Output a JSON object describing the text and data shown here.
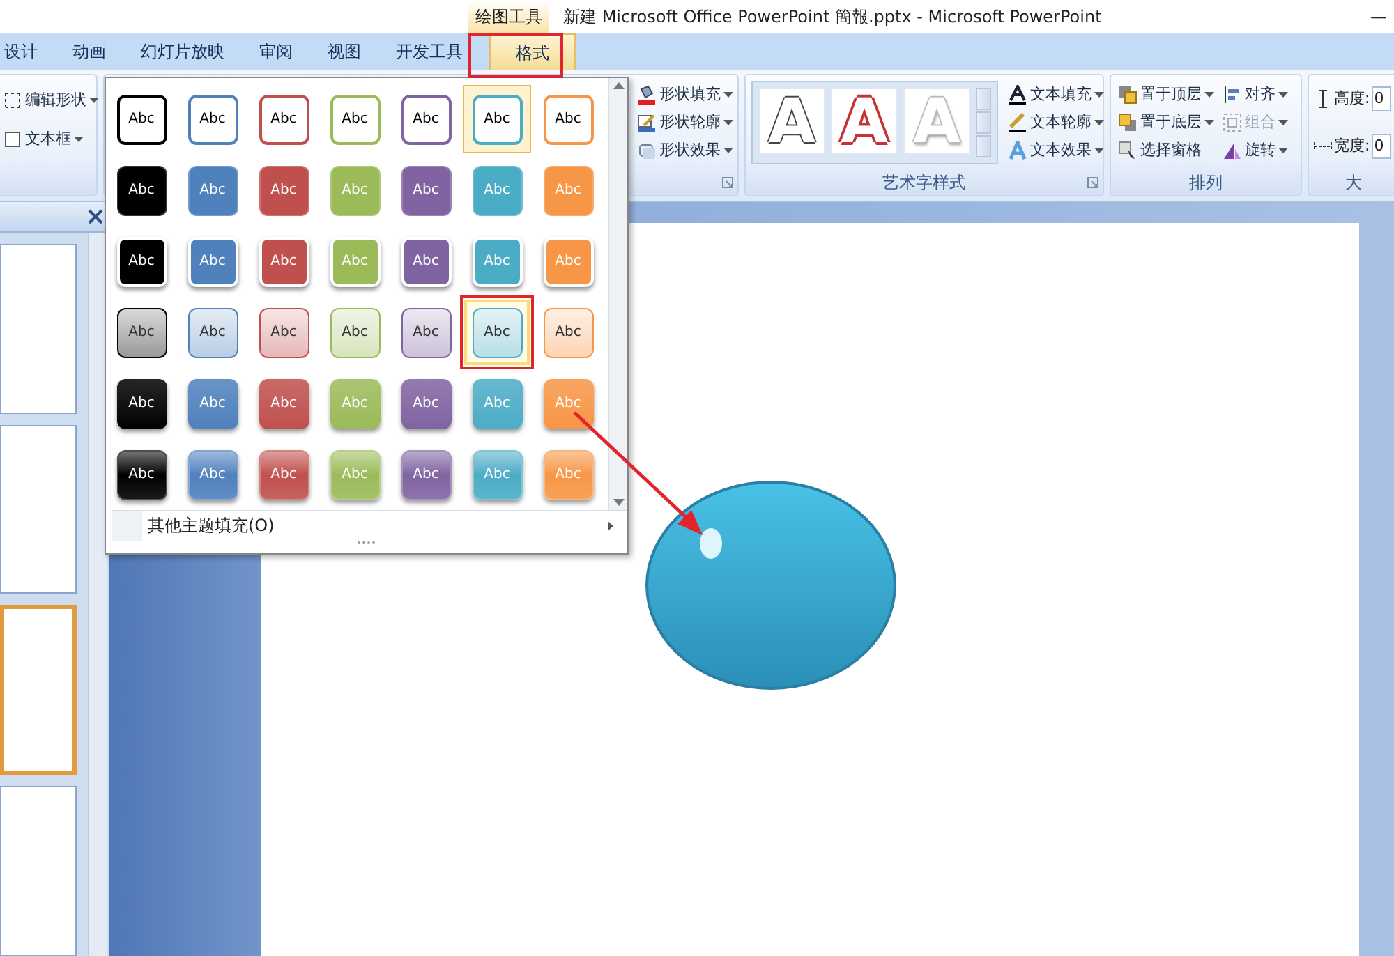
{
  "title_bar": {
    "context_label": "绘图工具",
    "title": "新建 Microsoft Office PowerPoint 簡報.pptx - Microsoft PowerPoint",
    "minimize": "—"
  },
  "tabs": [
    {
      "label": "设计",
      "selected": false
    },
    {
      "label": "动画",
      "selected": false
    },
    {
      "label": "幻灯片放映",
      "selected": false
    },
    {
      "label": "审阅",
      "selected": false
    },
    {
      "label": "视图",
      "selected": false
    },
    {
      "label": "开发工具",
      "selected": false
    },
    {
      "label": "格式",
      "selected": true
    }
  ],
  "ribbon": {
    "insert_shapes": {
      "items": [
        {
          "label": "编辑形状",
          "dropdown": true
        },
        {
          "label": "文本框",
          "dropdown": true
        }
      ]
    },
    "shape_styles": {
      "items": [
        {
          "label": "形状填充",
          "dropdown": true
        },
        {
          "label": "形状轮廓",
          "dropdown": true
        },
        {
          "label": "形状效果",
          "dropdown": true
        }
      ]
    },
    "wordart_styles": {
      "label": "艺术字样式",
      "samples": [
        {
          "text": "A",
          "kind": "outline"
        },
        {
          "text": "A",
          "kind": "red"
        },
        {
          "text": "A",
          "kind": "light"
        }
      ],
      "items": [
        {
          "label": "文本填充",
          "dropdown": true
        },
        {
          "label": "文本轮廓",
          "dropdown": true
        },
        {
          "label": "文本效果",
          "dropdown": true
        }
      ]
    },
    "arrange": {
      "label": "排列",
      "items": [
        {
          "label": "置于顶层",
          "dropdown": true,
          "disabled": false
        },
        {
          "label": "对齐",
          "dropdown": true,
          "disabled": false
        },
        {
          "label": "置于底层",
          "dropdown": true,
          "disabled": false
        },
        {
          "label": "组合",
          "dropdown": true,
          "disabled": true
        },
        {
          "label": "选择窗格",
          "dropdown": false,
          "disabled": false
        },
        {
          "label": "旋转",
          "dropdown": true,
          "disabled": false
        }
      ]
    },
    "size": {
      "label": "大",
      "fields": [
        {
          "label": "高度:",
          "value": "0"
        },
        {
          "label": "宽度:",
          "value": "0"
        }
      ]
    }
  },
  "gallery": {
    "rows": [
      {
        "kind": "outline",
        "items": [
          {
            "label": "Abc",
            "color": "#000000",
            "selected": false,
            "hovered": false
          },
          {
            "label": "Abc",
            "color": "#4f81bd",
            "selected": false,
            "hovered": false
          },
          {
            "label": "Abc",
            "color": "#c0504d",
            "selected": false,
            "hovered": false
          },
          {
            "label": "Abc",
            "color": "#9bbb59",
            "selected": false,
            "hovered": false
          },
          {
            "label": "Abc",
            "color": "#8064a2",
            "selected": false,
            "hovered": false
          },
          {
            "label": "Abc",
            "color": "#4bacc6",
            "selected": true,
            "hovered": false
          },
          {
            "label": "Abc",
            "color": "#f79646",
            "selected": false,
            "hovered": false
          }
        ]
      },
      {
        "kind": "solid",
        "items": [
          {
            "label": "Abc",
            "color": "#000000",
            "selected": false,
            "hovered": false
          },
          {
            "label": "Abc",
            "color": "#4f81bd",
            "selected": false,
            "hovered": false
          },
          {
            "label": "Abc",
            "color": "#c0504d",
            "selected": false,
            "hovered": false
          },
          {
            "label": "Abc",
            "color": "#9bbb59",
            "selected": false,
            "hovered": false
          },
          {
            "label": "Abc",
            "color": "#8064a2",
            "selected": false,
            "hovered": false
          },
          {
            "label": "Abc",
            "color": "#4bacc6",
            "selected": false,
            "hovered": false
          },
          {
            "label": "Abc",
            "color": "#f79646",
            "selected": false,
            "hovered": false
          }
        ]
      },
      {
        "kind": "shadow",
        "items": [
          {
            "label": "Abc",
            "color": "#000000",
            "selected": false,
            "hovered": false
          },
          {
            "label": "Abc",
            "color": "#4f81bd",
            "selected": false,
            "hovered": false
          },
          {
            "label": "Abc",
            "color": "#c0504d",
            "selected": false,
            "hovered": false
          },
          {
            "label": "Abc",
            "color": "#9bbb59",
            "selected": false,
            "hovered": false
          },
          {
            "label": "Abc",
            "color": "#8064a2",
            "selected": false,
            "hovered": false
          },
          {
            "label": "Abc",
            "color": "#4bacc6",
            "selected": false,
            "hovered": false
          },
          {
            "label": "Abc",
            "color": "#f79646",
            "selected": false,
            "hovered": false
          }
        ]
      },
      {
        "kind": "light",
        "items": [
          {
            "label": "Abc",
            "color": "#000000",
            "selected": false,
            "hovered": false
          },
          {
            "label": "Abc",
            "color": "#4f81bd",
            "selected": false,
            "hovered": false
          },
          {
            "label": "Abc",
            "color": "#c0504d",
            "selected": false,
            "hovered": false
          },
          {
            "label": "Abc",
            "color": "#9bbb59",
            "selected": false,
            "hovered": false
          },
          {
            "label": "Abc",
            "color": "#8064a2",
            "selected": false,
            "hovered": false
          },
          {
            "label": "Abc",
            "color": "#4bacc6",
            "selected": false,
            "hovered": true
          },
          {
            "label": "Abc",
            "color": "#f79646",
            "selected": false,
            "hovered": false
          }
        ]
      },
      {
        "kind": "intense",
        "items": [
          {
            "label": "Abc",
            "color": "#000000",
            "selected": false,
            "hovered": false
          },
          {
            "label": "Abc",
            "color": "#4f81bd",
            "selected": false,
            "hovered": false
          },
          {
            "label": "Abc",
            "color": "#c0504d",
            "selected": false,
            "hovered": false
          },
          {
            "label": "Abc",
            "color": "#9bbb59",
            "selected": false,
            "hovered": false
          },
          {
            "label": "Abc",
            "color": "#8064a2",
            "selected": false,
            "hovered": false
          },
          {
            "label": "Abc",
            "color": "#4bacc6",
            "selected": false,
            "hovered": false
          },
          {
            "label": "Abc",
            "color": "#f79646",
            "selected": false,
            "hovered": false
          }
        ]
      },
      {
        "kind": "glossy",
        "items": [
          {
            "label": "Abc",
            "color": "#000000",
            "selected": false,
            "hovered": false
          },
          {
            "label": "Abc",
            "color": "#4f81bd",
            "selected": false,
            "hovered": false
          },
          {
            "label": "Abc",
            "color": "#c0504d",
            "selected": false,
            "hovered": false
          },
          {
            "label": "Abc",
            "color": "#9bbb59",
            "selected": false,
            "hovered": false
          },
          {
            "label": "Abc",
            "color": "#8064a2",
            "selected": false,
            "hovered": false
          },
          {
            "label": "Abc",
            "color": "#4bacc6",
            "selected": false,
            "hovered": false
          },
          {
            "label": "Abc",
            "color": "#f79646",
            "selected": false,
            "hovered": false
          }
        ]
      }
    ],
    "more_item": "其他主题填充(O)"
  },
  "slide_thumbnails": [
    {
      "selected": false
    },
    {
      "selected": false
    },
    {
      "selected": true
    },
    {
      "selected": false
    }
  ]
}
